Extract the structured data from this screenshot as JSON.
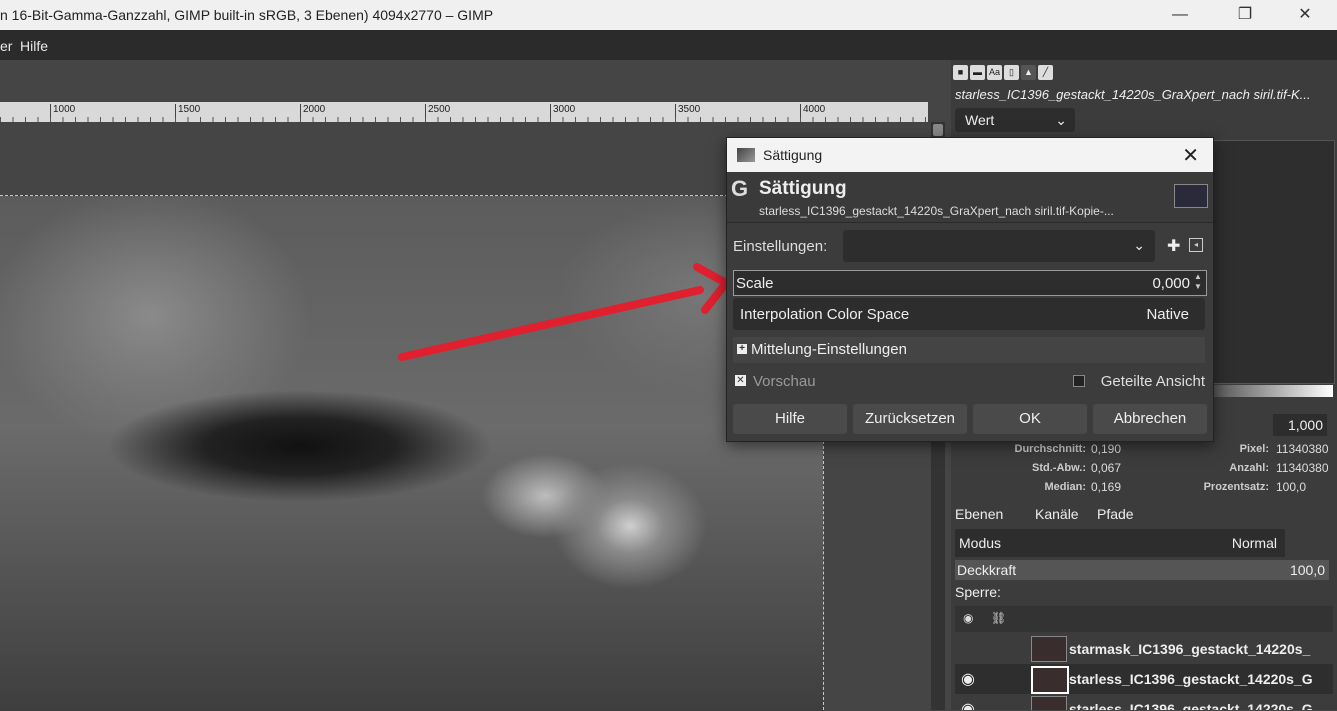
{
  "window": {
    "title": "n 16-Bit-Gamma-Ganzzahl, GIMP built-in sRGB, 3 Ebenen) 4094x2770 – GIMP",
    "minimize": "—",
    "maximize": "❐",
    "close": "✕"
  },
  "menu": {
    "items": [
      "er",
      "Hilfe"
    ]
  },
  "ruler": {
    "ticks": [
      "1000",
      "1500",
      "2000",
      "2500",
      "3000",
      "3500",
      "4000"
    ]
  },
  "histogram_panel": {
    "file": "starless_IC1396_gestackt_14220s_GraXpert_nach siril.tif-K...",
    "channel": "Wert",
    "value": "1,000",
    "stats_left": [
      {
        "k": "Durchschnitt:",
        "v": "0,190"
      },
      {
        "k": "Std.-Abw.:",
        "v": "0,067"
      },
      {
        "k": "Median:",
        "v": "0,169"
      }
    ],
    "stats_right": [
      {
        "k": "Pixel:",
        "v": "11340380"
      },
      {
        "k": "Anzahl:",
        "v": "11340380"
      },
      {
        "k": "Prozentsatz:",
        "v": "100,0"
      }
    ]
  },
  "layers_panel": {
    "tabs": [
      "Ebenen",
      "Kanäle",
      "Pfade"
    ],
    "mode_label": "Modus",
    "mode_value": "Normal",
    "opacity_label": "Deckkraft",
    "opacity_value": "100,0",
    "lock_label": "Sperre:",
    "layers": [
      {
        "name": "starmask_IC1396_gestackt_14220s_"
      },
      {
        "name": "starless_IC1396_gestackt_14220s_G"
      },
      {
        "name": "starless_IC1396_gestackt_14220s_G"
      }
    ]
  },
  "dialog": {
    "title": "Sättigung",
    "header_title": "Sättigung",
    "header_file": "starless_IC1396_gestackt_14220s_GraXpert_nach siril.tif-Kopie-...",
    "settings_label": "Einstellungen:",
    "scale_label": "Scale",
    "scale_value": "0,000",
    "interp_label": "Interpolation Color Space",
    "interp_value": "Native",
    "averaging_label": "Mittelung-Einstellungen",
    "preview_label": "Vorschau",
    "split_label": "Geteilte Ansicht",
    "buttons": {
      "help": "Hilfe",
      "reset": "Zurücksetzen",
      "ok": "OK",
      "cancel": "Abbrechen"
    }
  },
  "colors": {
    "arrow": "#e0202e",
    "selection": "#ffd400"
  }
}
